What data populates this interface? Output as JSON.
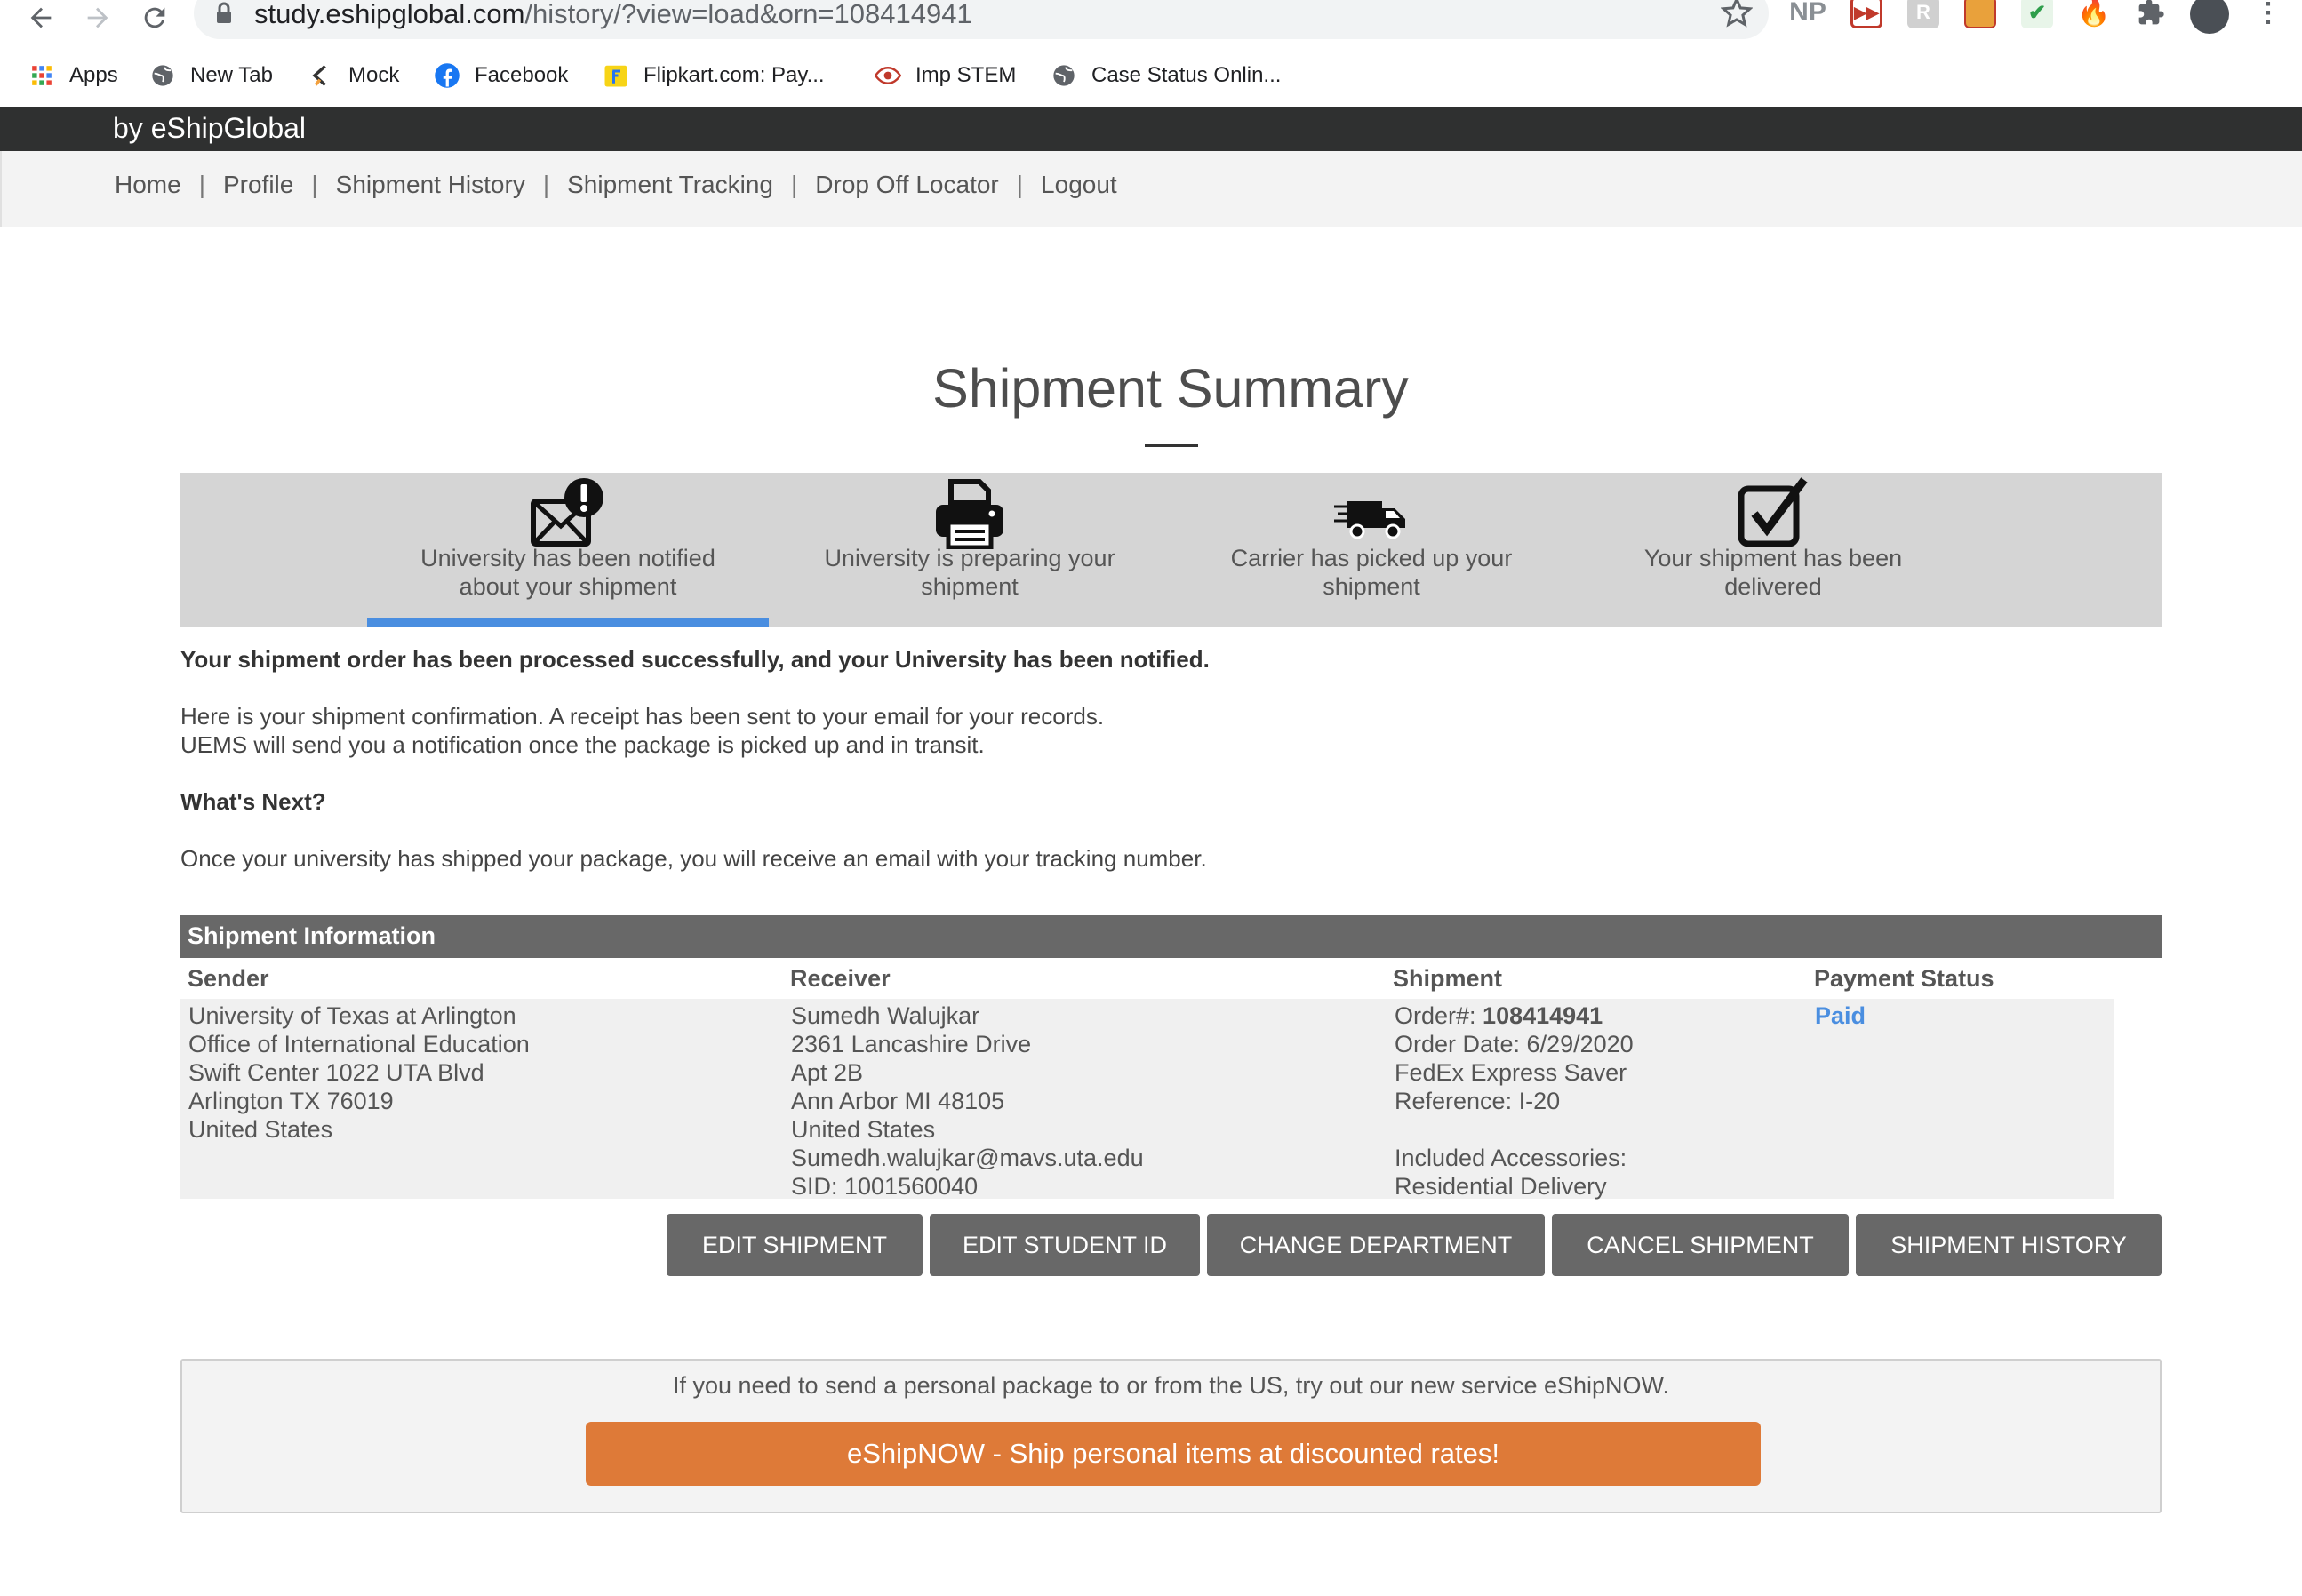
{
  "browser": {
    "url_host": "study.eshipglobal.com",
    "url_path": "/history/?view=load&orn=108414941",
    "extensions": [
      "NP",
      "video-ext",
      "R",
      "img-ext",
      "check-ext",
      "fire-ext",
      "puzzle-ext",
      "avatar"
    ],
    "bookmarks": [
      {
        "label": "Apps",
        "icon": "apps-grid-icon"
      },
      {
        "label": "New Tab",
        "icon": "globe-icon"
      },
      {
        "label": "Mock",
        "icon": "mock-icon"
      },
      {
        "label": "Facebook",
        "icon": "facebook-icon"
      },
      {
        "label": "Flipkart.com: Pay...",
        "icon": "flipkart-icon"
      },
      {
        "label": "Imp STEM",
        "icon": "eye-icon"
      },
      {
        "label": "Case Status Onlin...",
        "icon": "globe-icon"
      }
    ]
  },
  "site": {
    "brand": "by eShipGlobal",
    "menu": [
      "Home",
      "Profile",
      "Shipment History",
      "Shipment Tracking",
      "Drop Off Locator",
      "Logout"
    ],
    "separator": "|"
  },
  "page": {
    "title": "Shipment Summary",
    "steps": [
      {
        "line1": "University has been notified",
        "line2": "about your shipment",
        "icon": "mail-alert-icon",
        "active": true
      },
      {
        "line1": "University is preparing your",
        "line2": "shipment",
        "icon": "printer-icon",
        "active": false
      },
      {
        "line1": "Carrier has picked up your",
        "line2": "shipment",
        "icon": "truck-icon",
        "active": false
      },
      {
        "line1": "Your shipment has been",
        "line2": "delivered",
        "icon": "checkbox-icon",
        "active": false
      }
    ],
    "success_msg": "Your shipment order has been processed successfully, and your University has been notified.",
    "confirm_line1": "Here is your shipment confirmation. A receipt has been sent to your email for your records.",
    "confirm_line2": "UEMS will send you a notification once the package is picked up and in transit.",
    "whats_next": "What's Next?",
    "next_msg": "Once your university has shipped your package, you will receive an email with your tracking number."
  },
  "info": {
    "heading": "Shipment Information",
    "headers": {
      "sender": "Sender",
      "receiver": "Receiver",
      "shipment": "Shipment",
      "payment": "Payment Status"
    },
    "sender": [
      "University of Texas at Arlington",
      "Office of International Education",
      "Swift Center 1022 UTA Blvd",
      "Arlington TX 76019",
      "United States"
    ],
    "receiver": [
      "Sumedh Walujkar",
      "2361 Lancashire Drive",
      "Apt 2B",
      "Ann Arbor MI 48105",
      "United States",
      "Sumedh.walujkar@mavs.uta.edu",
      "SID: 1001560040"
    ],
    "shipment": {
      "order_label": "Order#: ",
      "order_number": "108414941",
      "order_date": "Order Date: 6/29/2020",
      "service": "FedEx Express Saver",
      "reference": "Reference: I-20",
      "accessories_label": "Included Accessories:",
      "accessories": "Residential Delivery"
    },
    "payment_status": "Paid",
    "payment_color": "#4a8ee0"
  },
  "actions": {
    "edit_shipment": "EDIT SHIPMENT",
    "edit_student_id": "EDIT STUDENT ID",
    "change_department": "CHANGE DEPARTMENT",
    "cancel_shipment": "CANCEL SHIPMENT",
    "shipment_history": "SHIPMENT HISTORY"
  },
  "promo": {
    "text": "If you need to send a personal package to or from the US, try out our new service eShipNOW.",
    "cta": "eShipNOW - Ship personal items at discounted rates!",
    "cta_color": "#de7a38"
  },
  "colors": {
    "header_bg": "#2f3030",
    "accent": "#4a8ee0",
    "button_bg": "#686868"
  }
}
